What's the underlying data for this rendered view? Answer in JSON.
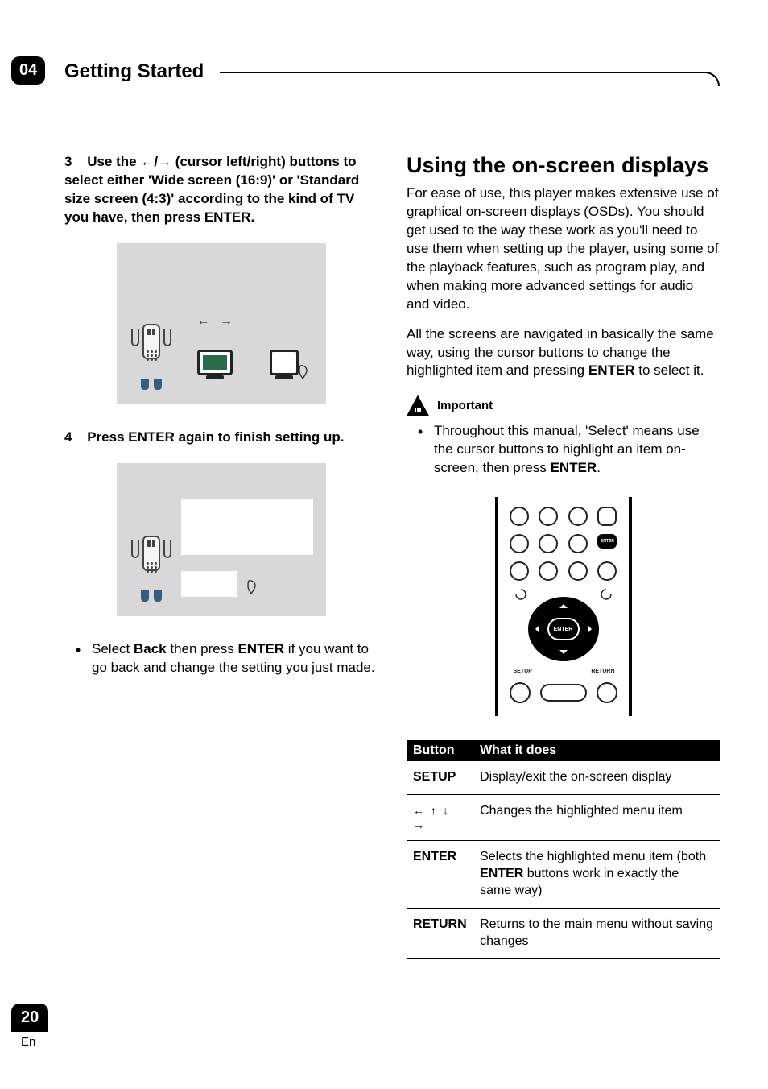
{
  "chapter_number": "04",
  "chapter_title": "Getting Started",
  "left": {
    "step3": {
      "num": "3",
      "text_a": "Use the ",
      "arrows": "←/→",
      "text_b": " (cursor left/right) buttons to select either 'Wide screen (16:9)' or 'Standard size screen (4:3)' according to the kind of TV you have, then press ENTER."
    },
    "arrow_indicator": "← →",
    "step4": {
      "num": "4",
      "text": "Press ENTER again to finish setting up."
    },
    "bullet": {
      "a": "Select ",
      "back": "Back",
      "b": " then press ",
      "enter": "ENTER",
      "c": " if you want to go back and change the setting you just made."
    }
  },
  "right": {
    "heading": "Using the on-screen displays",
    "p1": "For ease of use, this player makes extensive use of graphical on-screen displays (OSDs). You should get used to the way these work as you'll need to use them when setting up the player, using some of the playback features, such as program play, and when making more advanced settings for audio and video.",
    "p2_a": "All the screens are navigated in basically the same way, using the cursor buttons to change the highlighted item and pressing ",
    "p2_enter": "ENTER",
    "p2_b": " to select it.",
    "important_label": "Important",
    "important_bullet_a": "Throughout this manual, 'Select' means use the cursor buttons to highlight an item on-screen, then press ",
    "important_bullet_enter": "ENTER",
    "important_bullet_b": ".",
    "remote": {
      "enter_small": "ENTER",
      "enter_center": "ENTER",
      "setup": "SETUP",
      "return": "RETURN"
    },
    "table": {
      "head_button": "Button",
      "head_what": "What it does",
      "rows": [
        {
          "button": "SETUP",
          "desc": "Display/exit the on-screen display"
        },
        {
          "button_arrows": "← ↑ ↓ →",
          "desc": "Changes the highlighted menu item"
        },
        {
          "button": "ENTER",
          "desc_a": "Selects the highlighted menu item (both ",
          "desc_bold": "ENTER",
          "desc_b": " buttons work in exactly the same way)"
        },
        {
          "button": "RETURN",
          "desc": "Returns to the main menu without saving changes"
        }
      ]
    }
  },
  "page_number": "20",
  "page_lang": "En"
}
